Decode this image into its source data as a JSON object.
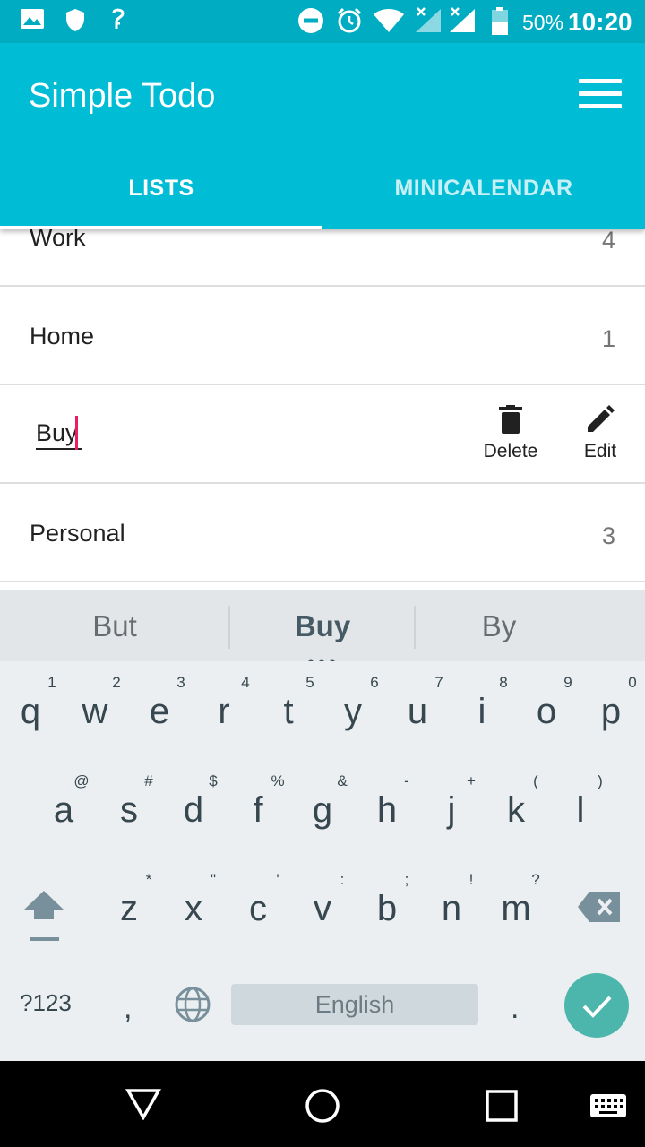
{
  "status_bar": {
    "battery": "50%",
    "time": "10:20"
  },
  "app": {
    "title": "Simple Todo"
  },
  "tabs": [
    {
      "label": "LISTS"
    },
    {
      "label": "MINICALENDAR"
    }
  ],
  "lists": [
    {
      "name": "Work",
      "count": "4"
    },
    {
      "name": "Home",
      "count": "1"
    },
    {
      "name": "Buy",
      "editing": true
    },
    {
      "name": "Personal",
      "count": "3"
    }
  ],
  "row_actions": {
    "delete": "Delete",
    "edit": "Edit"
  },
  "keyboard": {
    "suggestions": [
      "But",
      "Buy",
      "By"
    ],
    "row1": [
      "q",
      "w",
      "e",
      "r",
      "t",
      "y",
      "u",
      "i",
      "o",
      "p"
    ],
    "row1_hints": [
      "1",
      "2",
      "3",
      "4",
      "5",
      "6",
      "7",
      "8",
      "9",
      "0"
    ],
    "row2": [
      "a",
      "s",
      "d",
      "f",
      "g",
      "h",
      "j",
      "k",
      "l"
    ],
    "row2_hints": [
      "@",
      "#",
      "$",
      "%",
      "&",
      "-",
      "+",
      "(",
      ")"
    ],
    "row3": [
      "z",
      "x",
      "c",
      "v",
      "b",
      "n",
      "m"
    ],
    "row3_hints": [
      "*",
      "\"",
      "'",
      ":",
      ";",
      "!",
      "?"
    ],
    "symbols_key": "?123",
    "comma": ",",
    "period": ".",
    "space_label": "English"
  },
  "colors": {
    "accent": "#00BCD4",
    "statusbar": "#00ACC1",
    "cursor": "#E91E63",
    "enter": "#4DB6AC"
  }
}
